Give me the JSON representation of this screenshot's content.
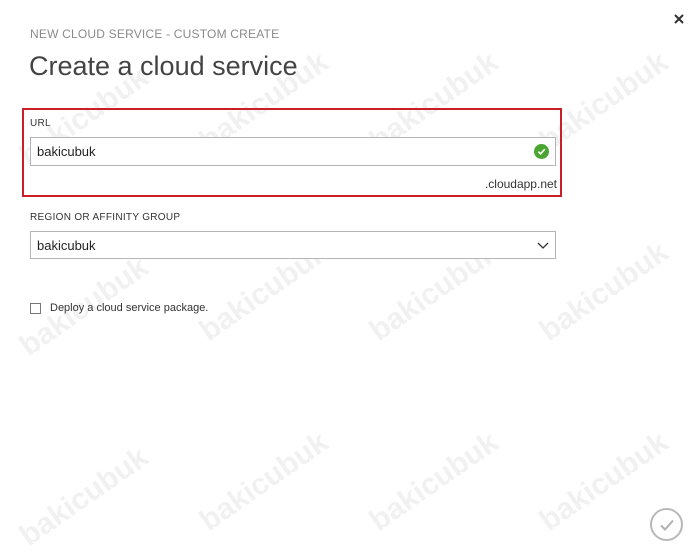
{
  "dialog": {
    "breadcrumb": "NEW CLOUD SERVICE - CUSTOM CREATE",
    "title": "Create a cloud service",
    "close_icon": "close-icon"
  },
  "url_field": {
    "label": "URL",
    "value": "bakicubuk",
    "suffix": ".cloudapp.net",
    "status_icon": "check-circle-icon",
    "status_color": "#4aa532",
    "highlight_color": "#cc1e25"
  },
  "region_field": {
    "label": "REGION OR AFFINITY GROUP",
    "selected": "bakicubuk",
    "icon": "chevron-down-icon"
  },
  "deploy_option": {
    "label": "Deploy a cloud service package.",
    "checked": false
  },
  "footer": {
    "ok_icon": "checkmark-icon"
  },
  "watermark": "bakicubuk"
}
